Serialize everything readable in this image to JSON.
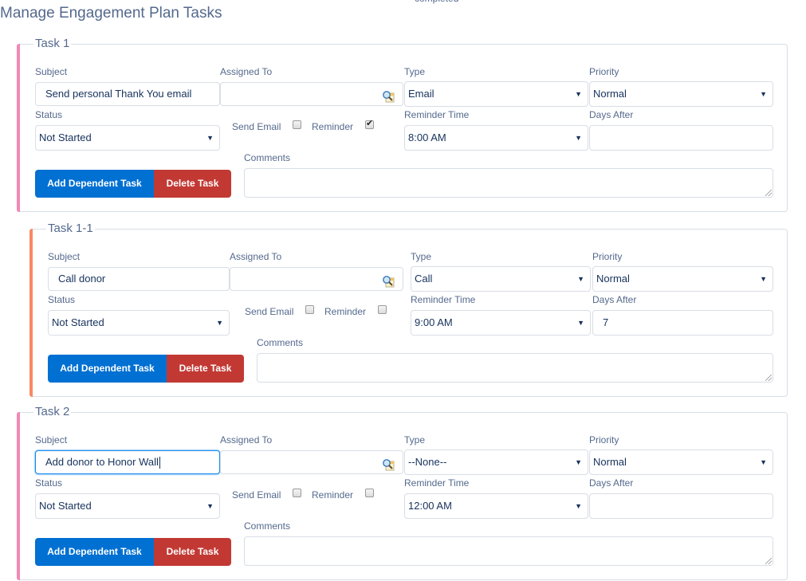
{
  "page": {
    "title": "Manage Engagement Plan Tasks",
    "top_cut_text": "completed"
  },
  "labels": {
    "subject": "Subject",
    "assigned_to": "Assigned To",
    "type": "Type",
    "priority": "Priority",
    "status": "Status",
    "send_email": "Send Email",
    "reminder": "Reminder",
    "reminder_time": "Reminder Time",
    "days_after": "Days After",
    "comments": "Comments",
    "add_dependent_task": "Add Dependent Task",
    "delete_task": "Delete Task"
  },
  "colors": {
    "task_accent_top_level": "#f088b6",
    "task_accent_dependent": "#f88962",
    "primary_button": "#0070d2",
    "destructive_button": "#c23934"
  },
  "tasks": [
    {
      "legend": "Task 1",
      "level": "top",
      "subject": "Send personal Thank You email",
      "assigned_to": "",
      "type": "Email",
      "priority": "Normal",
      "status": "Not Started",
      "send_email": false,
      "reminder": true,
      "reminder_time": "8:00 AM",
      "days_after": "",
      "comments": "",
      "subject_focused": false
    },
    {
      "legend": "Task 1-1",
      "level": "dependent",
      "subject": "Call donor",
      "assigned_to": "",
      "type": "Call",
      "priority": "Normal",
      "status": "Not Started",
      "send_email": false,
      "reminder": false,
      "reminder_time": "9:00 AM",
      "days_after": "7",
      "comments": "",
      "subject_focused": false
    },
    {
      "legend": "Task 2",
      "level": "top",
      "subject": "Add donor to Honor Wall",
      "assigned_to": "",
      "type": "--None--",
      "priority": "Normal",
      "status": "Not Started",
      "send_email": false,
      "reminder": false,
      "reminder_time": "12:00 AM",
      "days_after": "",
      "comments": "",
      "subject_focused": true
    }
  ],
  "icons": {
    "lookup": "magnifier-lookup-icon",
    "select_arrow": "▼",
    "checkmark": "✔"
  }
}
